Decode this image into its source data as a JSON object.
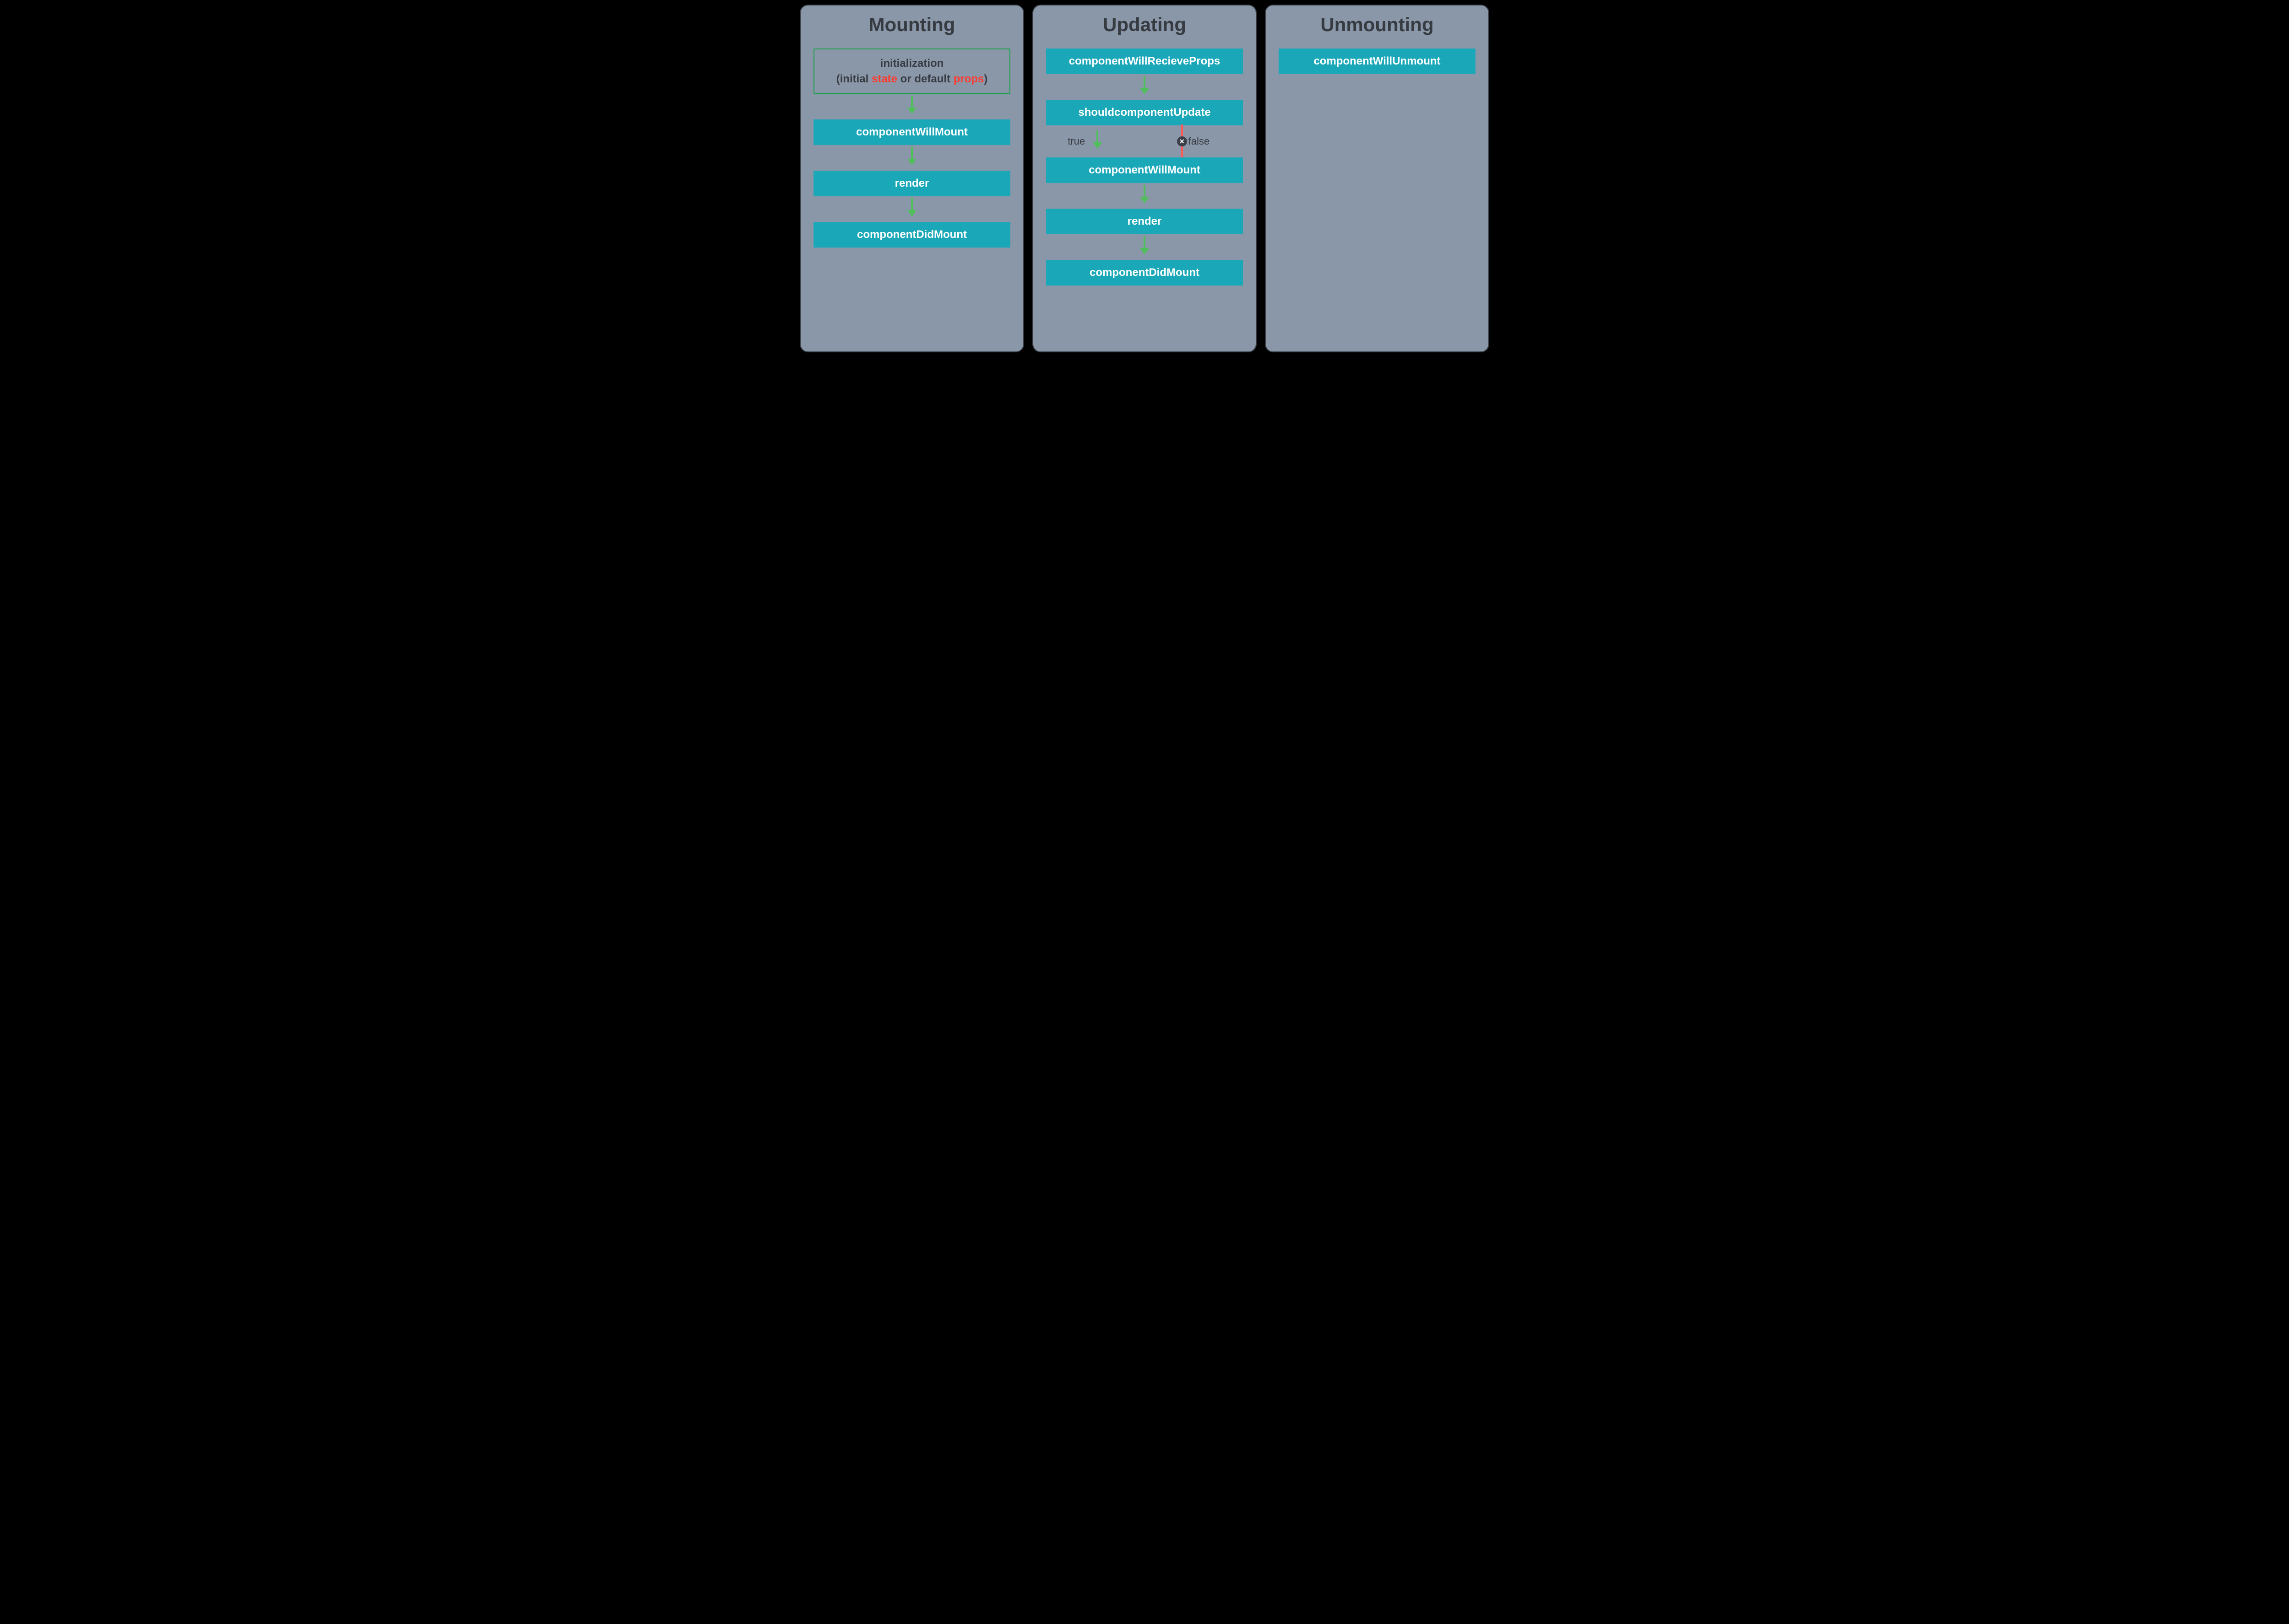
{
  "colors": {
    "panel_bg": "#8a97a8",
    "panel_border": "#3a3f47",
    "step_bg": "#1aa7b8",
    "step_text": "#ffffff",
    "arrow": "#4fbf5b",
    "initbox_border": "#1aa24a",
    "accent": "#ff3b30",
    "false_line": "#ff5a5a",
    "text_dark": "#363a41"
  },
  "mounting": {
    "title": "Mounting",
    "init_line1": "initialization",
    "init_line2_pre": "(initial ",
    "init_line2_state": "state",
    "init_line2_mid": " or default ",
    "init_line2_props": "props",
    "init_line2_post": ")",
    "steps": [
      "componentWillMount",
      "render",
      "componentDidMount"
    ]
  },
  "updating": {
    "title": "Updating",
    "steps": [
      "componentWillRecieveProps",
      "shouldcomponentUpdate",
      "componentWillMount",
      "render",
      "componentDidMount"
    ],
    "branch_true": "true",
    "branch_false": "false",
    "branch_false_glyph": "✕"
  },
  "unmounting": {
    "title": "Unmounting",
    "steps": [
      "componentWillUnmount"
    ]
  }
}
